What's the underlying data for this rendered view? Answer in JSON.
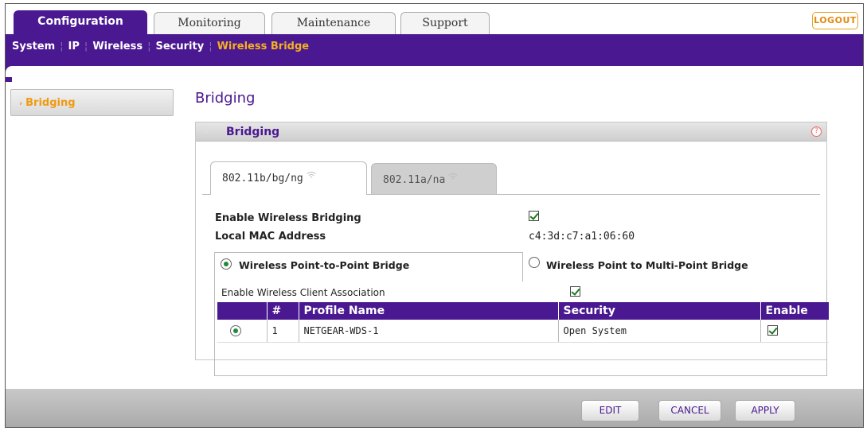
{
  "top_tabs": [
    {
      "label": "Configuration",
      "active": true
    },
    {
      "label": "Monitoring",
      "active": false
    },
    {
      "label": "Maintenance",
      "active": false
    },
    {
      "label": "Support",
      "active": false
    }
  ],
  "logout_label": "LOGOUT",
  "subnav": {
    "items": [
      "System",
      "IP",
      "Wireless",
      "Security",
      "Wireless Bridge"
    ],
    "current": "Wireless Bridge"
  },
  "sidebar": {
    "items": [
      {
        "label": "Bridging",
        "active": true
      }
    ]
  },
  "page_title": "Bridging",
  "panel": {
    "title": "Bridging",
    "help_icon": "help-icon"
  },
  "band_tabs": [
    {
      "label": "802.11b/bg/ng",
      "active": true
    },
    {
      "label": "802.11a/na",
      "active": false
    }
  ],
  "form": {
    "enable_bridging_label": "Enable Wireless Bridging",
    "enable_bridging_checked": true,
    "local_mac_label": "Local MAC Address",
    "local_mac_value": "c4:3d:c7:a1:06:60",
    "ptp_label": "Wireless Point-to-Point Bridge",
    "ptp_selected": true,
    "ptmp_label": "Wireless Point to Multi-Point Bridge",
    "ptmp_selected": false,
    "client_assoc_label": "Enable Wireless Client Association",
    "client_assoc_checked": true
  },
  "profiles_table": {
    "headers": [
      "",
      "#",
      "Profile Name",
      "Security",
      "Enable"
    ],
    "rows": [
      {
        "selected": true,
        "num": "1",
        "profile_name": "NETGEAR-WDS-1",
        "security": "Open System",
        "enabled": true
      }
    ]
  },
  "footer_buttons": {
    "edit": "EDIT",
    "cancel": "CANCEL",
    "apply": "APPLY"
  },
  "colors": {
    "brand_purple": "#4a1890",
    "accent_orange": "#f5b021",
    "check_green": "#1a7a1a"
  }
}
